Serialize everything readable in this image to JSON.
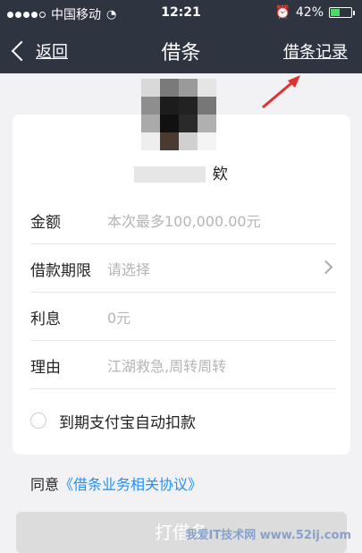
{
  "status_bar": {
    "carrier": "中国移动",
    "time": "12:21",
    "battery_text": "42%",
    "battery_level": 0.42
  },
  "nav": {
    "back_label": "返回",
    "title": "借条",
    "right_link": "借条记录"
  },
  "profile": {
    "name_suffix": "欸"
  },
  "form": {
    "amount_label": "金额",
    "amount_placeholder": "本次最多100,000.00元",
    "term_label": "借款期限",
    "term_placeholder": "请选择",
    "interest_label": "利息",
    "interest_value": "0元",
    "reason_label": "理由",
    "reason_placeholder": "江湖救急,周转周转",
    "auto_deduct_label": "到期支付宝自动扣款"
  },
  "agreement": {
    "prefix": "同意",
    "link": "《借条业务相关协议》"
  },
  "submit_label": "打借条",
  "watermark": "我爱IT技术网 www.52ij.com",
  "colors": {
    "nav_bg": "#2f3540",
    "accent": "#1e90ff",
    "annotation": "#e03030"
  }
}
